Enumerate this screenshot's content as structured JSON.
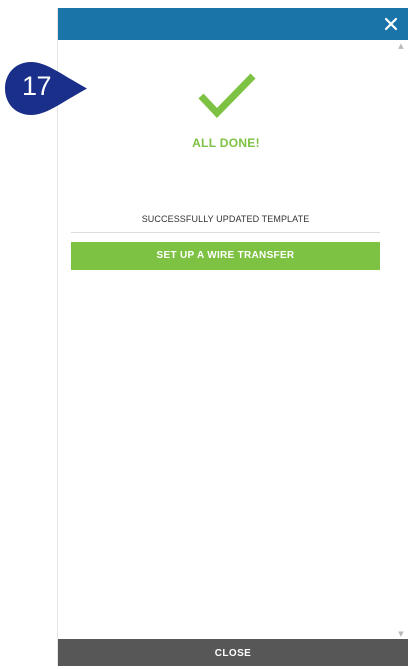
{
  "step_badge": {
    "number": "17",
    "color": "#1a2f8a"
  },
  "header": {
    "color": "#1b74a8",
    "close_icon": "close-icon"
  },
  "status": {
    "icon": "checkmark-icon",
    "title": "ALL DONE!",
    "accent": "#7dc242"
  },
  "message": "SUCCESSFULLY UPDATED TEMPLATE",
  "actions": {
    "wire_transfer_label": "SET UP A WIRE TRANSFER"
  },
  "scrollbar": {
    "up_icon": "scroll-up-arrow-icon",
    "down_icon": "scroll-down-arrow-icon"
  },
  "footer": {
    "close_label": "CLOSE",
    "color": "#575757"
  }
}
